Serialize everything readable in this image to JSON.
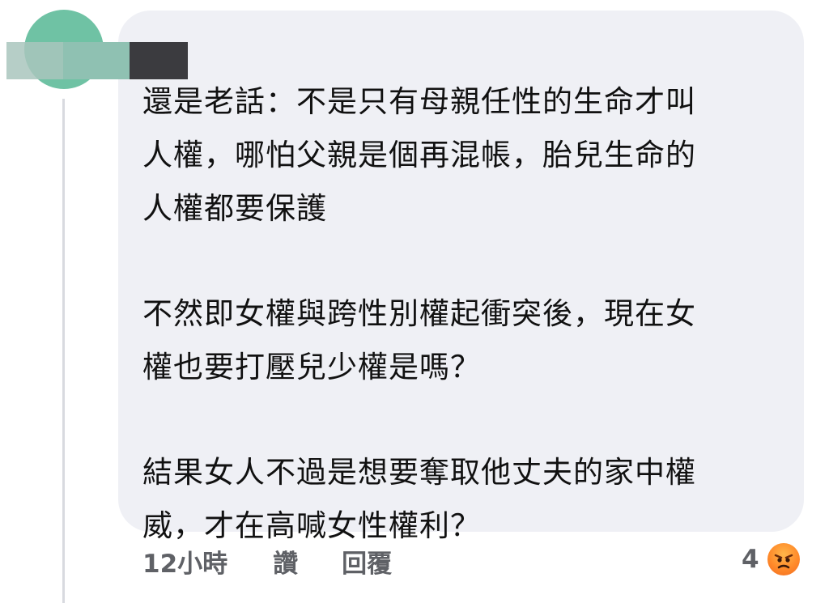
{
  "comment": {
    "paragraphs": [
      "還是老話：不是只有母親任性的生命才叫\n人權，哪怕父親是個再混帳，胎兒生命的\n人權都要保護",
      "不然即女權與跨性別權起衝突後，現在女\n權也要打壓兒少權是嗎？",
      "結果女人不過是想要奪取他丈夫的家中權\n威，才在高喊女性權利？"
    ]
  },
  "actions": {
    "timestamp": "12小時",
    "like_label": "讚",
    "reply_label": "回覆"
  },
  "reactions": {
    "count": "4",
    "icon": "angry-reaction-icon"
  },
  "colors": {
    "bubble_bg": "#eff0f5",
    "action_text": "#5f6166",
    "avatar": "#6fc2a4"
  }
}
